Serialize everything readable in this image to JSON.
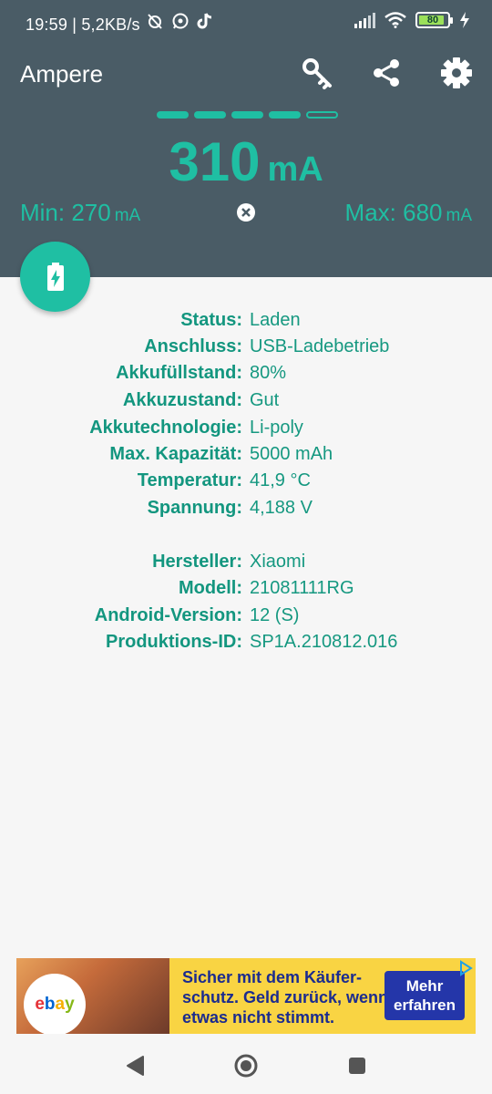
{
  "statusbar": {
    "time": "19:59",
    "speed": "| 5,2KB/s",
    "battery_pct": "80",
    "icons": [
      "alarm-off-icon",
      "whatsapp-icon",
      "tiktok-icon",
      "signal-icon",
      "wifi-icon",
      "battery-icon",
      "charging-icon"
    ]
  },
  "header": {
    "title": "Ampere",
    "actions": [
      "key-icon",
      "share-icon",
      "settings-icon"
    ],
    "level_filled": 4,
    "level_total": 5,
    "current_value": "310",
    "current_unit": "mA",
    "min_label": "Min: 270",
    "min_unit": "mA",
    "max_label": "Max: 680",
    "max_unit": "mA"
  },
  "fab_icon": "battery-charging-icon",
  "battery_info": [
    {
      "key": "Status:",
      "value": "Laden"
    },
    {
      "key": "Anschluss:",
      "value": "USB-Ladebetrieb"
    },
    {
      "key": "Akkufüllstand:",
      "value": "80%"
    },
    {
      "key": "Akkuzustand:",
      "value": "Gut"
    },
    {
      "key": "Akkutechnologie:",
      "value": "Li-poly"
    },
    {
      "key": "Max. Kapazität:",
      "value": "5000 mAh"
    },
    {
      "key": "Temperatur:",
      "value": "41,9 °C"
    },
    {
      "key": "Spannung:",
      "value": "4,188 V"
    }
  ],
  "device_info": [
    {
      "key": "Hersteller:",
      "value": "Xiaomi"
    },
    {
      "key": "Modell:",
      "value": "21081111RG"
    },
    {
      "key": "Android-Version:",
      "value": "12 (S)"
    },
    {
      "key": "Produktions-ID:",
      "value": "SP1A.210812.016"
    }
  ],
  "ad": {
    "brand": [
      "e",
      "b",
      "a",
      "y"
    ],
    "text": "Sicher mit dem Käufer-schutz. Geld zurück, wenn etwas nicht stimmt.",
    "cta": "Mehr erfahren"
  },
  "colors": {
    "header_bg": "#4a5c66",
    "accent": "#1fbfa3",
    "label_text": "#13967f",
    "ad_bg": "#f9d443",
    "ad_cta": "#2436a9"
  }
}
